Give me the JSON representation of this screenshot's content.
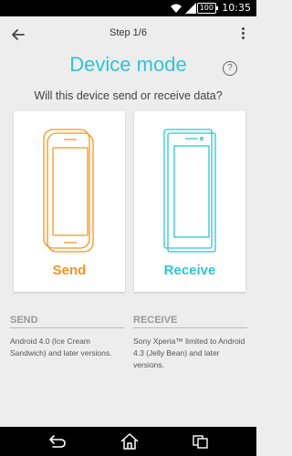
{
  "status_bar": {
    "time": "10:35",
    "battery": "100"
  },
  "app_bar": {
    "step": "Step 1/6"
  },
  "title": "Device mode",
  "help_label": "?",
  "question": "Will this device send or receive data?",
  "cards": {
    "send": {
      "label": "Send",
      "color": "#f7941d"
    },
    "receive": {
      "label": "Receive",
      "color": "#2ec6d4"
    }
  },
  "info": {
    "send": {
      "heading": "SEND",
      "text": "Android 4.0 (Ice Cream Sandwich) and later versions."
    },
    "receive": {
      "heading": "RECEIVE",
      "text": "Sony Xperia™ limited to Android 4.3 (Jelly Bean) and later versions."
    }
  },
  "icons": [
    "wifi-icon",
    "signal-icon",
    "battery-icon",
    "back-arrow-icon",
    "more-vert-icon",
    "help-icon",
    "nav-back-icon",
    "nav-home-icon",
    "nav-recents-icon"
  ]
}
